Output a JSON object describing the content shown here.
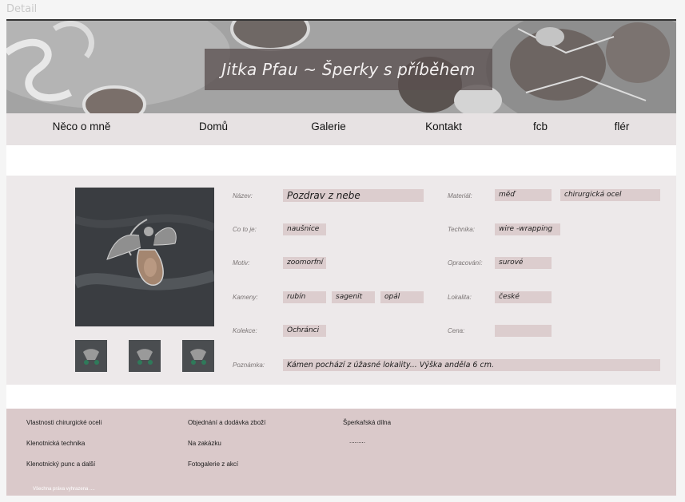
{
  "frame": {
    "label": "Detail"
  },
  "header": {
    "title": "Jitka Pfau ~ Šperky s příběhem"
  },
  "nav": {
    "items": [
      {
        "label": "Něco o mně"
      },
      {
        "label": "Domů"
      },
      {
        "label": "Galerie"
      },
      {
        "label": "Kontakt"
      },
      {
        "label": "fcb"
      },
      {
        "label": "flér"
      }
    ]
  },
  "detail": {
    "labels": {
      "name": "Název:",
      "what": "Co to je:",
      "motif": "Motiv:",
      "stones": "Kameny:",
      "collection": "Kolekce:",
      "note": "Poznámka:",
      "material": "Materiál:",
      "technique": "Technika:",
      "finish": "Opracování:",
      "locality": "Lokalita:",
      "price": "Cena:"
    },
    "values": {
      "name": "Pozdrav z nebe",
      "what": "naušnice",
      "motif": "zoomorfní",
      "stones": [
        "rubín",
        "sagenit",
        "opál"
      ],
      "collection": "Ochránci",
      "note": "Kámen pochází z úžasné lokality... Výška anděla 6 cm.",
      "material": [
        "měď",
        "chirurgická ocel"
      ],
      "technique": "wire -wrapping",
      "finish": "surové",
      "locality": "české",
      "price": ""
    }
  },
  "footer": {
    "col1": [
      "Vlastnosti chirurgické oceli",
      "Klenotnická technika",
      "Klenotnický punc a další"
    ],
    "col2": [
      "Objednání a dodávka zboží",
      "Na zakázku",
      "Fotogalerie z akcí"
    ],
    "col3": [
      "Šperkařská dílna",
      "........."
    ],
    "rights": "Všechna práva vyhrazena ...."
  },
  "colors": {
    "nav_bg": "#e7e2e3",
    "detail_bg": "#ede9ea",
    "field_bg": "#dccdce",
    "footer_bg": "#dac9ca"
  }
}
